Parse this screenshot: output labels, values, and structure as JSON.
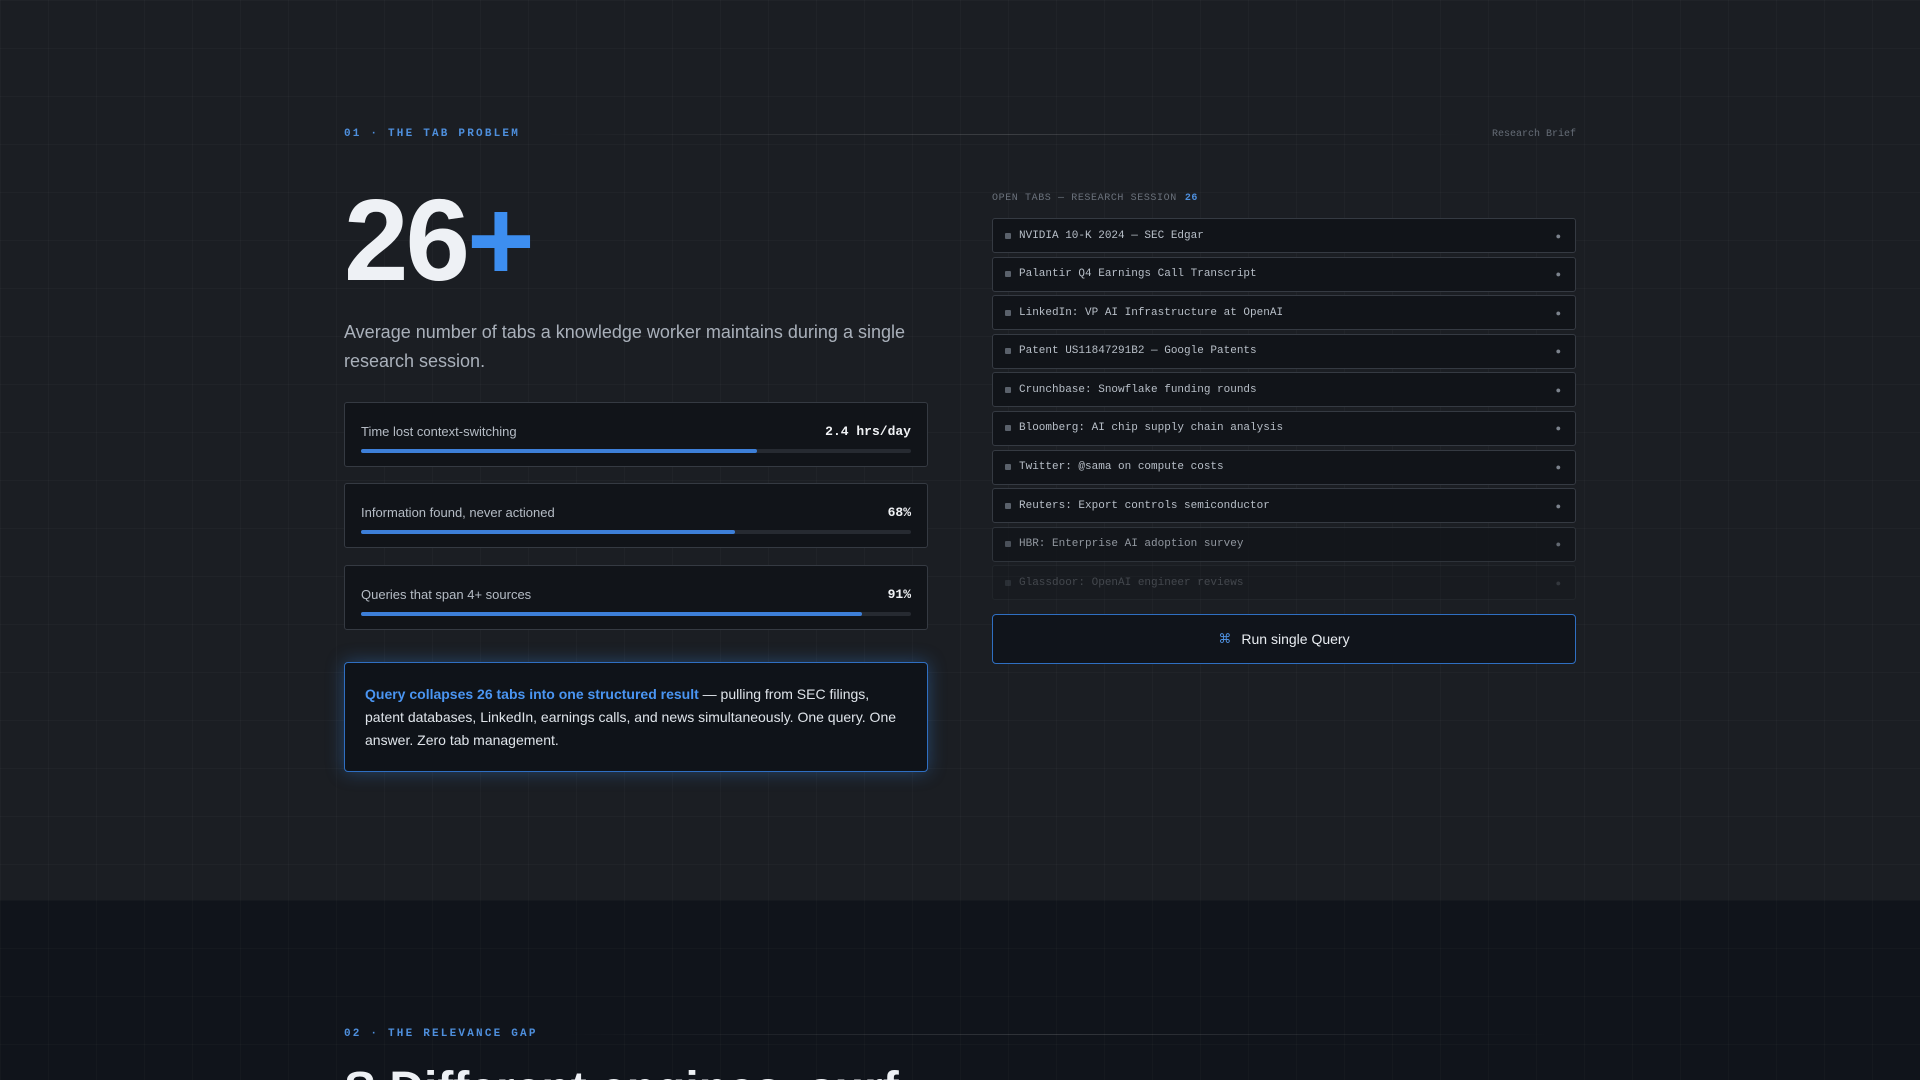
{
  "section1": {
    "label": "01 · THE TAB PROBLEM",
    "right_label": "Research Brief",
    "big_number": "26",
    "big_number_suffix": "+",
    "lead": "Average number of tabs a knowledge worker maintains during a single research session.",
    "metrics": [
      {
        "label": "Time lost context-switching",
        "value": "2.4 hrs/day",
        "fill": 0.72
      },
      {
        "label": "Information found, never actioned",
        "value": "68%",
        "fill": 0.68
      },
      {
        "label": "Queries that span 4+ sources",
        "value": "91%",
        "fill": 0.91
      }
    ],
    "callout": {
      "highlight": "Query collapses 26 tabs into one structured result",
      "rest": " — pulling from SEC filings, patent databases, LinkedIn, earnings calls, and news simultaneously. One query. One answer. Zero tab management."
    },
    "tabs_header": "OPEN TABS — RESEARCH SESSION",
    "tabs_count": "26",
    "tabs": [
      "NVIDIA 10-K 2024 — SEC Edgar",
      "Palantir Q4 Earnings Call Transcript",
      "LinkedIn: VP AI Infrastructure at OpenAI",
      "Patent US11847291B2 — Google Patents",
      "Crunchbase: Snowflake funding rounds",
      "Bloomberg: AI chip supply chain analysis",
      "Twitter: @sama on compute costs",
      "Reuters: Export controls semiconductor",
      "HBR: Enterprise AI adoption survey",
      "Glassdoor: OpenAI engineer reviews"
    ],
    "tab_close_glyph": "●",
    "run_button_icon": "⌘",
    "run_button_label": "Run single Query"
  },
  "section2": {
    "label": "02 · THE RELEVANCE GAP",
    "heading": "S              Different engines, surf"
  },
  "colors": {
    "accent": "#3d8ef0",
    "background": "#1b1e23",
    "section2_background": "#10141b"
  }
}
